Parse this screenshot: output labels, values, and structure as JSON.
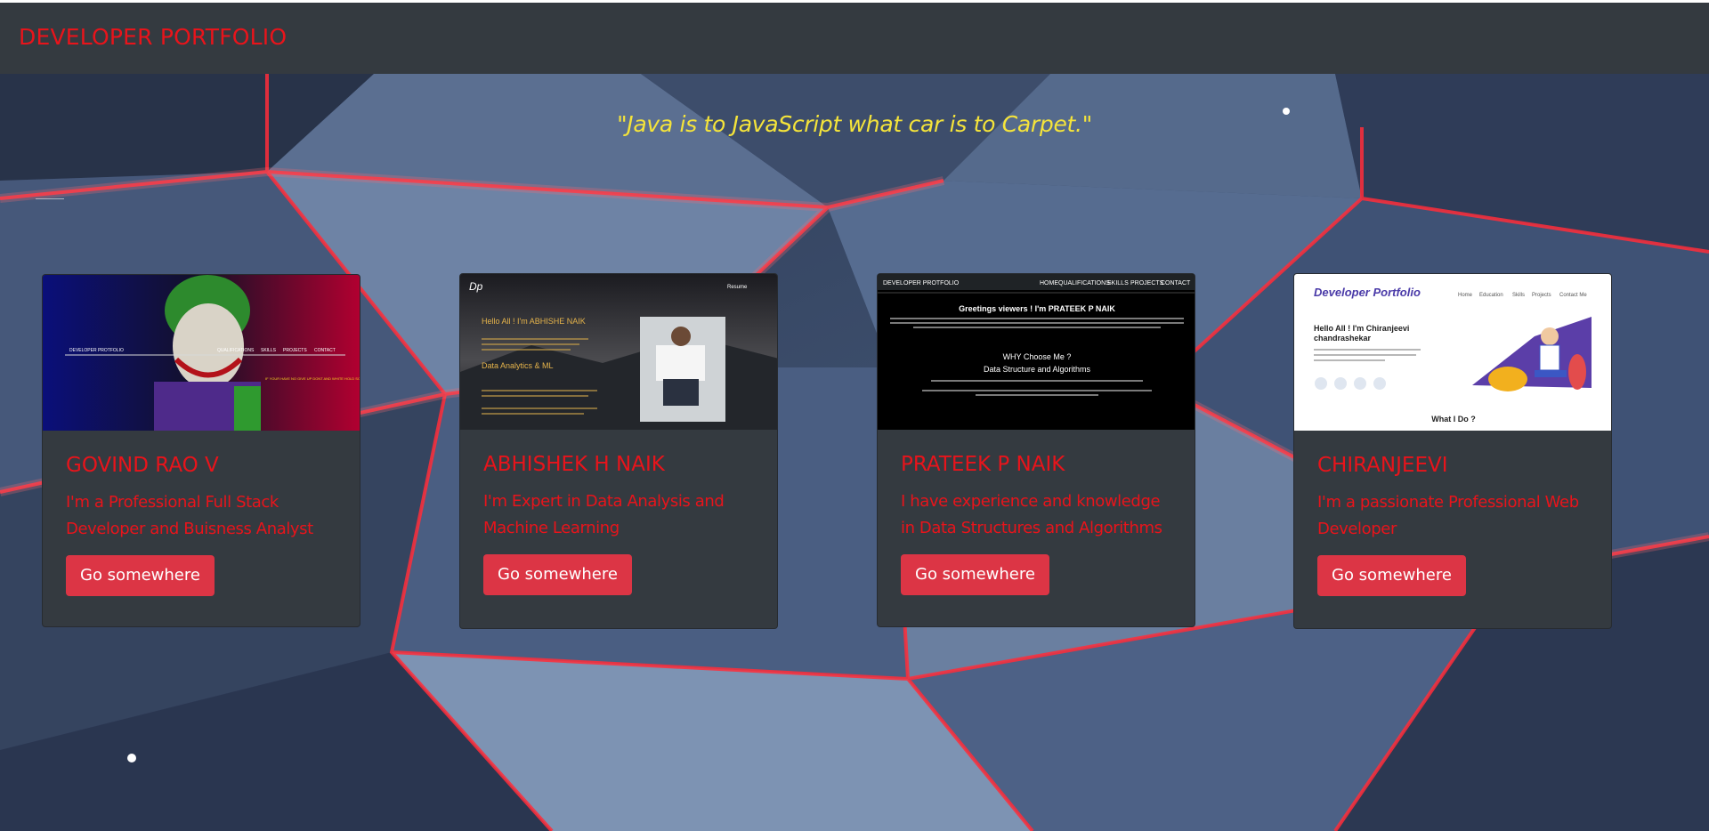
{
  "navbar": {
    "brand": "DEVELOPER PORTFOLIO"
  },
  "hero": {
    "quote": "\"Java is to JavaScript what car is to Carpet.\""
  },
  "cards": [
    {
      "title": "GOVIND RAO V",
      "text": "I'm a Professional Full Stack Developer and Buisness Analyst",
      "button": "Go somewhere",
      "preview": {
        "nav_brand": "DEVELOPER PROTFOLIO",
        "nav_items": [
          "QUALIFICATIONS",
          "SKILLS",
          "PROJECTS",
          "CONTACT"
        ],
        "tagline": "IF YOUR HAVE NO GIVE UP DONT AND WHITE HOLD SOMETHING"
      }
    },
    {
      "title": "ABHISHEK H NAIK",
      "text": "I'm Expert in Data Analysis and Machine Learning",
      "button": "Go somewhere",
      "preview": {
        "logo": "Dp",
        "nav_item": "Resume",
        "greeting": "Hello All ! I'm ABHISHE NAIK",
        "section": "Data Analytics & ML"
      }
    },
    {
      "title": "PRATEEK P NAIK",
      "text": "I have experience and knowledge in Data Structures and Algorithms",
      "button": "Go somewhere",
      "preview": {
        "nav_brand": "DEVELOPER PROTFOLIO",
        "nav_items": [
          "HOME",
          "QUALIFICATIONS",
          "SKILLS",
          "PROJECTS",
          "CONTACT"
        ],
        "greeting": "Greetings viewers ! I'm PRATEEK P NAIK",
        "why": "WHY Choose Me ?",
        "topic": "Data Structure and Algorithms"
      }
    },
    {
      "title": "CHIRANJEEVI",
      "text": "I'm a passionate Professional Web Developer",
      "button": "Go somewhere",
      "preview": {
        "logo": "Developer Portfolio",
        "nav_items": [
          "Home",
          "Education",
          "Skills",
          "Projects",
          "Contact Me"
        ],
        "greeting_line1": "Hello All ! I'm Chiranjeevi",
        "greeting_line2": "chandrashekar",
        "section": "What I Do ?"
      }
    }
  ]
}
